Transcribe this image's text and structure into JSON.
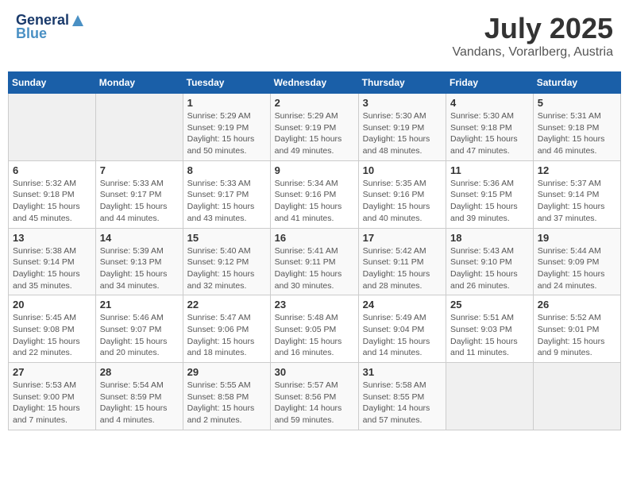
{
  "header": {
    "logo_line1": "General",
    "logo_line2": "Blue",
    "month_year": "July 2025",
    "location": "Vandans, Vorarlberg, Austria"
  },
  "weekdays": [
    "Sunday",
    "Monday",
    "Tuesday",
    "Wednesday",
    "Thursday",
    "Friday",
    "Saturday"
  ],
  "weeks": [
    [
      {
        "day": "",
        "info": ""
      },
      {
        "day": "",
        "info": ""
      },
      {
        "day": "1",
        "info": "Sunrise: 5:29 AM\nSunset: 9:19 PM\nDaylight: 15 hours and 50 minutes."
      },
      {
        "day": "2",
        "info": "Sunrise: 5:29 AM\nSunset: 9:19 PM\nDaylight: 15 hours and 49 minutes."
      },
      {
        "day": "3",
        "info": "Sunrise: 5:30 AM\nSunset: 9:19 PM\nDaylight: 15 hours and 48 minutes."
      },
      {
        "day": "4",
        "info": "Sunrise: 5:30 AM\nSunset: 9:18 PM\nDaylight: 15 hours and 47 minutes."
      },
      {
        "day": "5",
        "info": "Sunrise: 5:31 AM\nSunset: 9:18 PM\nDaylight: 15 hours and 46 minutes."
      }
    ],
    [
      {
        "day": "6",
        "info": "Sunrise: 5:32 AM\nSunset: 9:18 PM\nDaylight: 15 hours and 45 minutes."
      },
      {
        "day": "7",
        "info": "Sunrise: 5:33 AM\nSunset: 9:17 PM\nDaylight: 15 hours and 44 minutes."
      },
      {
        "day": "8",
        "info": "Sunrise: 5:33 AM\nSunset: 9:17 PM\nDaylight: 15 hours and 43 minutes."
      },
      {
        "day": "9",
        "info": "Sunrise: 5:34 AM\nSunset: 9:16 PM\nDaylight: 15 hours and 41 minutes."
      },
      {
        "day": "10",
        "info": "Sunrise: 5:35 AM\nSunset: 9:16 PM\nDaylight: 15 hours and 40 minutes."
      },
      {
        "day": "11",
        "info": "Sunrise: 5:36 AM\nSunset: 9:15 PM\nDaylight: 15 hours and 39 minutes."
      },
      {
        "day": "12",
        "info": "Sunrise: 5:37 AM\nSunset: 9:14 PM\nDaylight: 15 hours and 37 minutes."
      }
    ],
    [
      {
        "day": "13",
        "info": "Sunrise: 5:38 AM\nSunset: 9:14 PM\nDaylight: 15 hours and 35 minutes."
      },
      {
        "day": "14",
        "info": "Sunrise: 5:39 AM\nSunset: 9:13 PM\nDaylight: 15 hours and 34 minutes."
      },
      {
        "day": "15",
        "info": "Sunrise: 5:40 AM\nSunset: 9:12 PM\nDaylight: 15 hours and 32 minutes."
      },
      {
        "day": "16",
        "info": "Sunrise: 5:41 AM\nSunset: 9:11 PM\nDaylight: 15 hours and 30 minutes."
      },
      {
        "day": "17",
        "info": "Sunrise: 5:42 AM\nSunset: 9:11 PM\nDaylight: 15 hours and 28 minutes."
      },
      {
        "day": "18",
        "info": "Sunrise: 5:43 AM\nSunset: 9:10 PM\nDaylight: 15 hours and 26 minutes."
      },
      {
        "day": "19",
        "info": "Sunrise: 5:44 AM\nSunset: 9:09 PM\nDaylight: 15 hours and 24 minutes."
      }
    ],
    [
      {
        "day": "20",
        "info": "Sunrise: 5:45 AM\nSunset: 9:08 PM\nDaylight: 15 hours and 22 minutes."
      },
      {
        "day": "21",
        "info": "Sunrise: 5:46 AM\nSunset: 9:07 PM\nDaylight: 15 hours and 20 minutes."
      },
      {
        "day": "22",
        "info": "Sunrise: 5:47 AM\nSunset: 9:06 PM\nDaylight: 15 hours and 18 minutes."
      },
      {
        "day": "23",
        "info": "Sunrise: 5:48 AM\nSunset: 9:05 PM\nDaylight: 15 hours and 16 minutes."
      },
      {
        "day": "24",
        "info": "Sunrise: 5:49 AM\nSunset: 9:04 PM\nDaylight: 15 hours and 14 minutes."
      },
      {
        "day": "25",
        "info": "Sunrise: 5:51 AM\nSunset: 9:03 PM\nDaylight: 15 hours and 11 minutes."
      },
      {
        "day": "26",
        "info": "Sunrise: 5:52 AM\nSunset: 9:01 PM\nDaylight: 15 hours and 9 minutes."
      }
    ],
    [
      {
        "day": "27",
        "info": "Sunrise: 5:53 AM\nSunset: 9:00 PM\nDaylight: 15 hours and 7 minutes."
      },
      {
        "day": "28",
        "info": "Sunrise: 5:54 AM\nSunset: 8:59 PM\nDaylight: 15 hours and 4 minutes."
      },
      {
        "day": "29",
        "info": "Sunrise: 5:55 AM\nSunset: 8:58 PM\nDaylight: 15 hours and 2 minutes."
      },
      {
        "day": "30",
        "info": "Sunrise: 5:57 AM\nSunset: 8:56 PM\nDaylight: 14 hours and 59 minutes."
      },
      {
        "day": "31",
        "info": "Sunrise: 5:58 AM\nSunset: 8:55 PM\nDaylight: 14 hours and 57 minutes."
      },
      {
        "day": "",
        "info": ""
      },
      {
        "day": "",
        "info": ""
      }
    ]
  ]
}
